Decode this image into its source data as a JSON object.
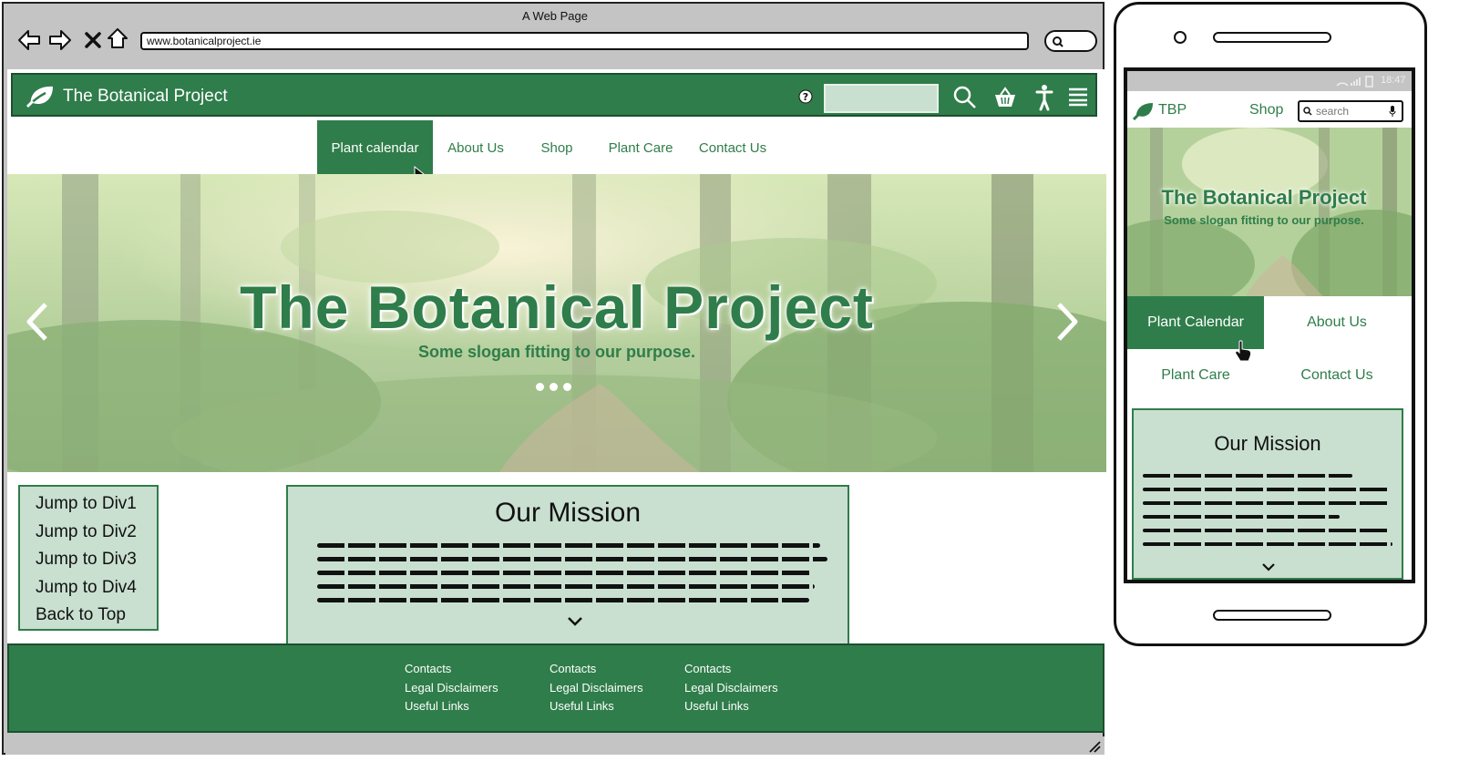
{
  "browser": {
    "window_title": "A Web Page",
    "url": "www.botanicalproject.ie"
  },
  "site": {
    "brand": "The Botanical Project",
    "nav": [
      {
        "label": "Plant calendar",
        "active": true
      },
      {
        "label": "About Us",
        "active": false
      },
      {
        "label": "Shop",
        "active": false
      },
      {
        "label": "Plant Care",
        "active": false
      },
      {
        "label": "Contact Us",
        "active": false
      }
    ],
    "hero": {
      "title": "The Botanical Project",
      "slogan": "Some slogan fitting to our purpose."
    },
    "jump_links": [
      "Jump to Div1",
      "Jump to Div2",
      "Jump to Div3",
      "Jump to Div4",
      "Back to Top"
    ],
    "mission": {
      "title": "Our Mission"
    },
    "footer": {
      "columns": [
        {
          "links": [
            "Contacts",
            "Legal Disclaimers",
            "Useful Links"
          ]
        },
        {
          "links": [
            "Contacts",
            "Legal Disclaimers",
            "Useful Links"
          ]
        },
        {
          "links": [
            "Contacts",
            "Legal Disclaimers",
            "Useful Links"
          ]
        }
      ]
    },
    "icons": [
      "help-icon",
      "search-icon",
      "basket-icon",
      "accessibility-icon",
      "menu-icon"
    ]
  },
  "mobile": {
    "time": "18:47",
    "brand": "TBP",
    "shop_label": "Shop",
    "search_placeholder": "search",
    "hero_title": "The Botanical Project",
    "hero_slogan": "Some slogan fitting to our purpose.",
    "nav": [
      {
        "label": "Plant Calendar",
        "active": true
      },
      {
        "label": "About Us",
        "active": false
      },
      {
        "label": "Plant Care",
        "active": false
      },
      {
        "label": "Contact Us",
        "active": false
      }
    ],
    "mission_title": "Our Mission"
  },
  "colors": {
    "primary": "#2f7d4a",
    "light": "#c9e0d0",
    "frame": "#c4c4c4"
  }
}
